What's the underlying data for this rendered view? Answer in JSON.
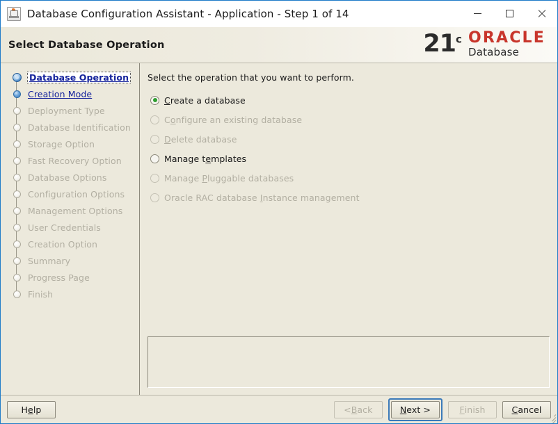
{
  "window": {
    "title": "Database Configuration Assistant - Application - Step 1 of 14",
    "app_icon": "java-coffee-cup-icon",
    "controls": {
      "minimize": "minimize-icon",
      "maximize": "maximize-icon",
      "close": "close-icon"
    },
    "border_color": "#1e7bc8"
  },
  "header": {
    "title": "Select Database Operation",
    "logo": {
      "version": "21",
      "version_sup": "c",
      "brand": "ORACLE",
      "product": "Database",
      "brand_color": "#c8352b"
    }
  },
  "sidebar": {
    "steps": [
      {
        "label": "Database Operation",
        "state": "current"
      },
      {
        "label": "Creation Mode",
        "state": "done"
      },
      {
        "label": "Deployment Type",
        "state": "pending"
      },
      {
        "label": "Database Identification",
        "state": "pending"
      },
      {
        "label": "Storage Option",
        "state": "pending"
      },
      {
        "label": "Fast Recovery Option",
        "state": "pending"
      },
      {
        "label": "Database Options",
        "state": "pending"
      },
      {
        "label": "Configuration Options",
        "state": "pending"
      },
      {
        "label": "Management Options",
        "state": "pending"
      },
      {
        "label": "User Credentials",
        "state": "pending"
      },
      {
        "label": "Creation Option",
        "state": "pending"
      },
      {
        "label": "Summary",
        "state": "pending"
      },
      {
        "label": "Progress Page",
        "state": "pending"
      },
      {
        "label": "Finish",
        "state": "pending"
      }
    ]
  },
  "main": {
    "prompt": "Select the operation that you want to perform.",
    "options": [
      {
        "pre": "",
        "mnemonic": "C",
        "post": "reate a database",
        "selected": true,
        "enabled": true
      },
      {
        "pre": "C",
        "mnemonic": "o",
        "post": "nfigure an existing database",
        "selected": false,
        "enabled": false
      },
      {
        "pre": "",
        "mnemonic": "D",
        "post": "elete database",
        "selected": false,
        "enabled": false
      },
      {
        "pre": "Manage t",
        "mnemonic": "e",
        "post": "mplates",
        "selected": false,
        "enabled": true
      },
      {
        "pre": "Manage ",
        "mnemonic": "P",
        "post": "luggable databases",
        "selected": false,
        "enabled": false
      },
      {
        "pre": "Oracle RAC database ",
        "mnemonic": "I",
        "post": "nstance management",
        "selected": false,
        "enabled": false
      }
    ],
    "message_panel_text": ""
  },
  "buttons": {
    "help": {
      "pre": "H",
      "mnemonic": "e",
      "post": "lp",
      "enabled": true,
      "focused": false
    },
    "back": {
      "pre": "< ",
      "mnemonic": "B",
      "post": "ack",
      "enabled": false,
      "focused": false
    },
    "next": {
      "pre": "",
      "mnemonic": "N",
      "post": "ext >",
      "enabled": true,
      "focused": true
    },
    "finish": {
      "pre": "",
      "mnemonic": "F",
      "post": "inish",
      "enabled": false,
      "focused": false
    },
    "cancel": {
      "pre": "",
      "mnemonic": "C",
      "post": "ancel",
      "enabled": true,
      "focused": false
    }
  }
}
